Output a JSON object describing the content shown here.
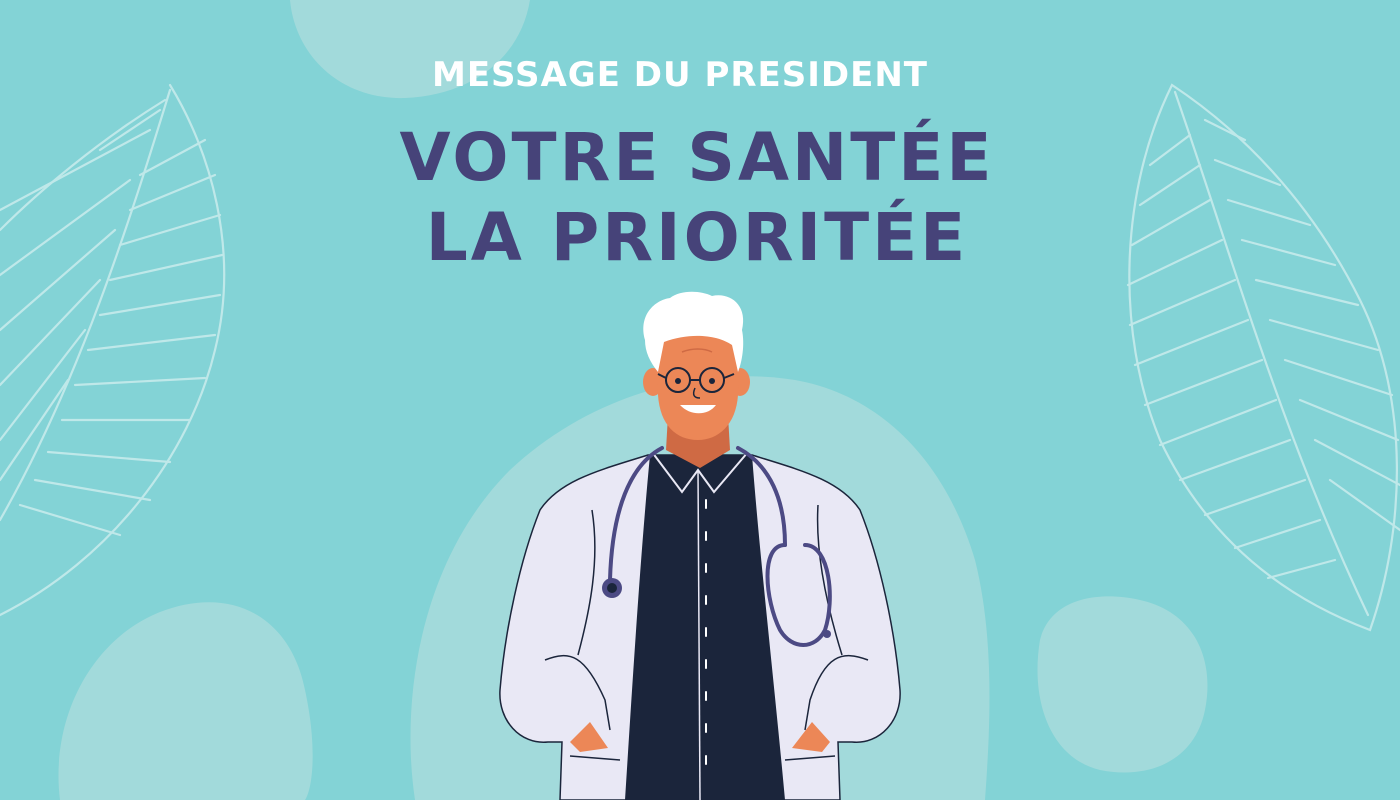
{
  "header": {
    "kicker": "MESSAGE DU PRESIDENT",
    "title_line1": "VOTRE SANTÉE",
    "title_line2": "LA PRIORITÉE"
  },
  "colors": {
    "background": "#83d3d6",
    "blob": "#a2dadb",
    "leaf_line": "#bfe8e9",
    "title": "#464379",
    "kicker": "#ffffff",
    "coat": "#e9e8f5",
    "shirt": "#1b253b",
    "skin": "#ec8757",
    "stethoscope": "#4c4a84",
    "hair": "#ffffff"
  },
  "illustration": {
    "subject": "doctor-with-stethoscope",
    "decor": [
      "left-leaf",
      "right-leaf",
      "background-blobs"
    ]
  }
}
